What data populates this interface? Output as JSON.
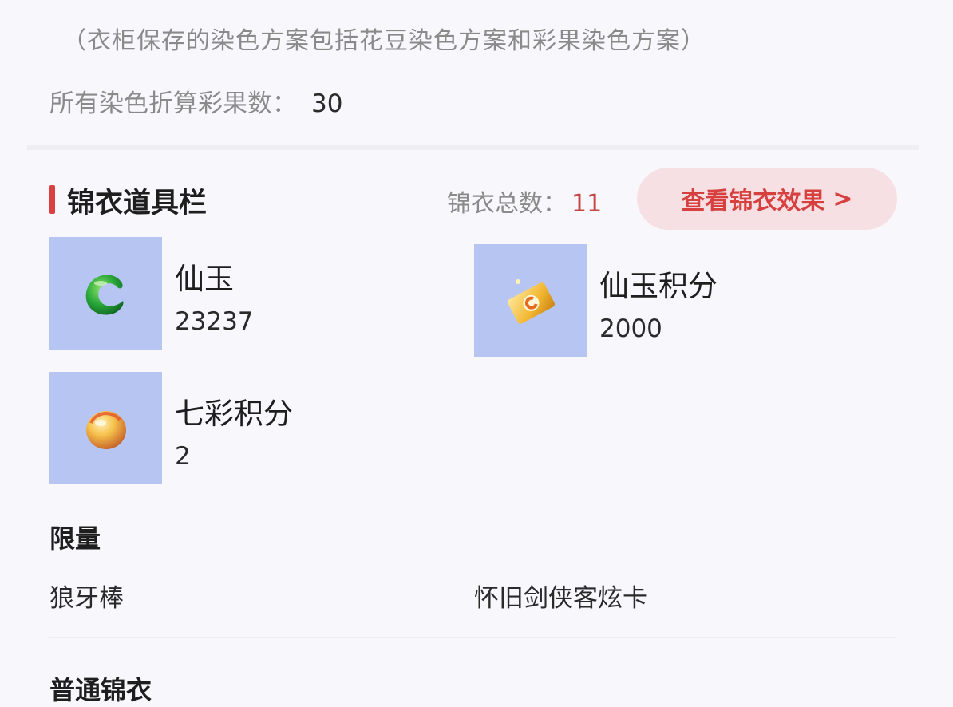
{
  "note": "（衣柜保存的染色方案包括花豆染色方案和彩果染色方案）",
  "dye_total": {
    "label": "所有染色折算彩果数：",
    "value": "30"
  },
  "section": {
    "title": "锦衣道具栏",
    "total_label": "锦衣总数：",
    "total_value": "11",
    "button_label": "查看锦衣效果",
    "button_chevron": ">"
  },
  "items": [
    {
      "name": "仙玉",
      "count": "23237",
      "icon": "green-jade-icon"
    },
    {
      "name": "仙玉积分",
      "count": "2000",
      "icon": "gold-coupon-icon"
    },
    {
      "name": "七彩积分",
      "count": "2",
      "icon": "orange-orb-icon"
    }
  ],
  "limited": {
    "title": "限量",
    "entries": [
      "狼牙棒",
      "怀旧剑侠客炫卡"
    ]
  },
  "normal": {
    "title": "普通锦衣"
  },
  "colors": {
    "accent": "#d9403f",
    "button_bg": "#f7e0e4",
    "thumb_bg": "#b6c5f2",
    "count_highlight": "#c64545"
  }
}
